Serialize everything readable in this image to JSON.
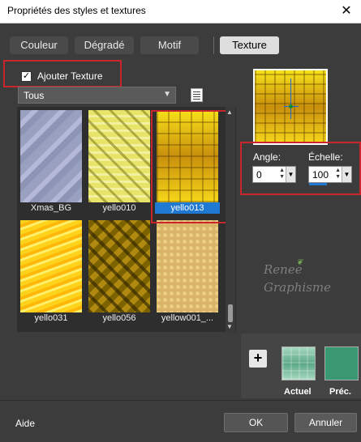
{
  "window": {
    "title": "Propriétés des styles et textures",
    "close_glyph": "✕"
  },
  "tabs": [
    {
      "label": "Couleur",
      "active": false
    },
    {
      "label": "Dégradé",
      "active": false
    },
    {
      "label": "Motif",
      "active": false
    },
    {
      "label": "Texture",
      "active": true
    }
  ],
  "texture": {
    "add_texture_label": "Ajouter Texture",
    "add_texture_checked": true,
    "category": "Tous",
    "tiles": [
      {
        "name": "Xmas_BG",
        "selected": false
      },
      {
        "name": "yello010",
        "selected": false
      },
      {
        "name": "yello013",
        "selected": true
      },
      {
        "name": "yello031",
        "selected": false
      },
      {
        "name": "yello056",
        "selected": false
      },
      {
        "name": "yellow001_...",
        "selected": false
      }
    ]
  },
  "params": {
    "angle_label": "Angle:",
    "angle_value": "0",
    "scale_label": "Échelle:",
    "scale_value": "100"
  },
  "watermark": {
    "line1": "Renee",
    "line2": "Graphisme"
  },
  "swatches": {
    "current_label": "Actuel",
    "previous_label": "Préc.",
    "previous_color": "#3a9873",
    "add_glyph": "+"
  },
  "footer": {
    "help": "Aide",
    "ok": "OK",
    "cancel": "Annuler"
  },
  "colors": {
    "selection": "#1f78d1",
    "highlight_box": "#c8262c"
  }
}
